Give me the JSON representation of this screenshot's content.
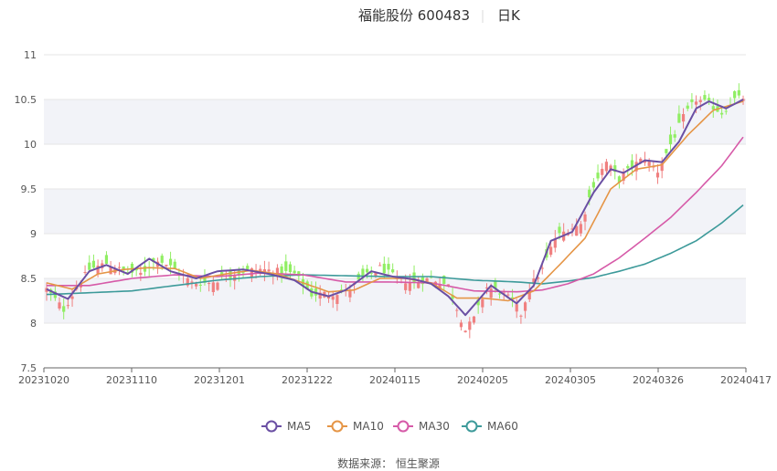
{
  "title": {
    "stock": "福能股份 600483",
    "period": "日K"
  },
  "source": "数据来源： 恒生聚源",
  "colors": {
    "up": "#f08080",
    "down": "#90ee63",
    "ma5": "#6a4fa3",
    "ma10": "#e59546",
    "ma30": "#d65aa8",
    "ma60": "#3d9a9a",
    "band": "#f2f3f8"
  },
  "chart_data": {
    "type": "candlestick",
    "ylim": [
      7.5,
      11
    ],
    "y_ticks": [
      "11",
      "10.5",
      "10",
      "9.5",
      "9",
      "8.5",
      "8",
      "7.5"
    ],
    "x_ticks": [
      "20231020",
      "20231110",
      "20231201",
      "20231222",
      "20240115",
      "20240205",
      "20240305",
      "20240326",
      "20240417"
    ],
    "legend": [
      {
        "name": "MA5",
        "key": "ma5"
      },
      {
        "name": "MA10",
        "key": "ma10"
      },
      {
        "name": "MA30",
        "key": "ma30"
      },
      {
        "name": "MA60",
        "key": "ma60"
      }
    ],
    "close_anchors": [
      [
        0,
        8.38
      ],
      [
        4,
        8.15
      ],
      [
        7,
        8.4
      ],
      [
        10,
        8.6
      ],
      [
        14,
        8.67
      ],
      [
        18,
        8.58
      ],
      [
        22,
        8.55
      ],
      [
        26,
        8.72
      ],
      [
        30,
        8.6
      ],
      [
        34,
        8.45
      ],
      [
        38,
        8.45
      ],
      [
        42,
        8.52
      ],
      [
        46,
        8.58
      ],
      [
        50,
        8.6
      ],
      [
        54,
        8.58
      ],
      [
        58,
        8.55
      ],
      [
        62,
        8.32
      ],
      [
        66,
        8.33
      ],
      [
        70,
        8.35
      ],
      [
        74,
        8.5
      ],
      [
        78,
        8.62
      ],
      [
        82,
        8.5
      ],
      [
        86,
        8.45
      ],
      [
        90,
        8.5
      ],
      [
        94,
        8.42
      ],
      [
        98,
        7.92
      ],
      [
        100,
        8.05
      ],
      [
        103,
        8.4
      ],
      [
        106,
        8.35
      ],
      [
        109,
        8.25
      ],
      [
        111,
        8.1
      ],
      [
        113,
        8.4
      ],
      [
        116,
        8.6
      ],
      [
        119,
        8.95
      ],
      [
        122,
        9.05
      ],
      [
        125,
        9.1
      ],
      [
        128,
        9.55
      ],
      [
        131,
        9.8
      ],
      [
        134,
        9.6
      ],
      [
        137,
        9.75
      ],
      [
        140,
        9.85
      ],
      [
        143,
        9.7
      ],
      [
        146,
        10.0
      ],
      [
        149,
        10.3
      ],
      [
        152,
        10.5
      ],
      [
        155,
        10.45
      ],
      [
        158,
        10.35
      ],
      [
        161,
        10.5
      ],
      [
        163,
        10.52
      ]
    ],
    "ma_anchors": {
      "ma5": [
        [
          0,
          8.38
        ],
        [
          5,
          8.27
        ],
        [
          10,
          8.58
        ],
        [
          14,
          8.65
        ],
        [
          19,
          8.55
        ],
        [
          24,
          8.72
        ],
        [
          29,
          8.58
        ],
        [
          35,
          8.5
        ],
        [
          40,
          8.58
        ],
        [
          46,
          8.6
        ],
        [
          52,
          8.55
        ],
        [
          58,
          8.48
        ],
        [
          62,
          8.35
        ],
        [
          66,
          8.3
        ],
        [
          70,
          8.37
        ],
        [
          76,
          8.58
        ],
        [
          81,
          8.52
        ],
        [
          86,
          8.49
        ],
        [
          90,
          8.44
        ],
        [
          94,
          8.3
        ],
        [
          98,
          8.09
        ],
        [
          104,
          8.42
        ],
        [
          110,
          8.22
        ],
        [
          114,
          8.42
        ],
        [
          118,
          8.92
        ],
        [
          123,
          9.02
        ],
        [
          128,
          9.46
        ],
        [
          132,
          9.72
        ],
        [
          135,
          9.68
        ],
        [
          140,
          9.82
        ],
        [
          144,
          9.8
        ],
        [
          148,
          10.03
        ],
        [
          152,
          10.4
        ],
        [
          155,
          10.48
        ],
        [
          159,
          10.4
        ],
        [
          163,
          10.5
        ]
      ],
      "ma10": [
        [
          0,
          8.45
        ],
        [
          6,
          8.38
        ],
        [
          12,
          8.55
        ],
        [
          18,
          8.6
        ],
        [
          24,
          8.62
        ],
        [
          30,
          8.61
        ],
        [
          36,
          8.5
        ],
        [
          42,
          8.55
        ],
        [
          48,
          8.59
        ],
        [
          54,
          8.55
        ],
        [
          60,
          8.45
        ],
        [
          66,
          8.35
        ],
        [
          72,
          8.37
        ],
        [
          78,
          8.5
        ],
        [
          84,
          8.5
        ],
        [
          90,
          8.45
        ],
        [
          96,
          8.28
        ],
        [
          102,
          8.28
        ],
        [
          108,
          8.25
        ],
        [
          114,
          8.36
        ],
        [
          120,
          8.65
        ],
        [
          126,
          8.95
        ],
        [
          132,
          9.5
        ],
        [
          138,
          9.72
        ],
        [
          144,
          9.77
        ],
        [
          150,
          10.1
        ],
        [
          156,
          10.38
        ],
        [
          163,
          10.48
        ]
      ],
      "ma30": [
        [
          0,
          8.42
        ],
        [
          10,
          8.42
        ],
        [
          20,
          8.5
        ],
        [
          30,
          8.54
        ],
        [
          40,
          8.52
        ],
        [
          50,
          8.56
        ],
        [
          60,
          8.54
        ],
        [
          70,
          8.46
        ],
        [
          80,
          8.46
        ],
        [
          90,
          8.45
        ],
        [
          100,
          8.36
        ],
        [
          110,
          8.35
        ],
        [
          116,
          8.37
        ],
        [
          122,
          8.44
        ],
        [
          128,
          8.55
        ],
        [
          134,
          8.73
        ],
        [
          140,
          8.95
        ],
        [
          146,
          9.18
        ],
        [
          152,
          9.46
        ],
        [
          158,
          9.76
        ],
        [
          163,
          10.08
        ]
      ],
      "ma60": [
        [
          0,
          8.32
        ],
        [
          10,
          8.34
        ],
        [
          20,
          8.36
        ],
        [
          30,
          8.42
        ],
        [
          40,
          8.48
        ],
        [
          50,
          8.52
        ],
        [
          60,
          8.54
        ],
        [
          70,
          8.53
        ],
        [
          80,
          8.52
        ],
        [
          90,
          8.52
        ],
        [
          100,
          8.48
        ],
        [
          110,
          8.46
        ],
        [
          116,
          8.44
        ],
        [
          122,
          8.47
        ],
        [
          128,
          8.51
        ],
        [
          134,
          8.58
        ],
        [
          140,
          8.66
        ],
        [
          146,
          8.78
        ],
        [
          152,
          8.92
        ],
        [
          158,
          9.12
        ],
        [
          163,
          9.32
        ]
      ]
    }
  }
}
